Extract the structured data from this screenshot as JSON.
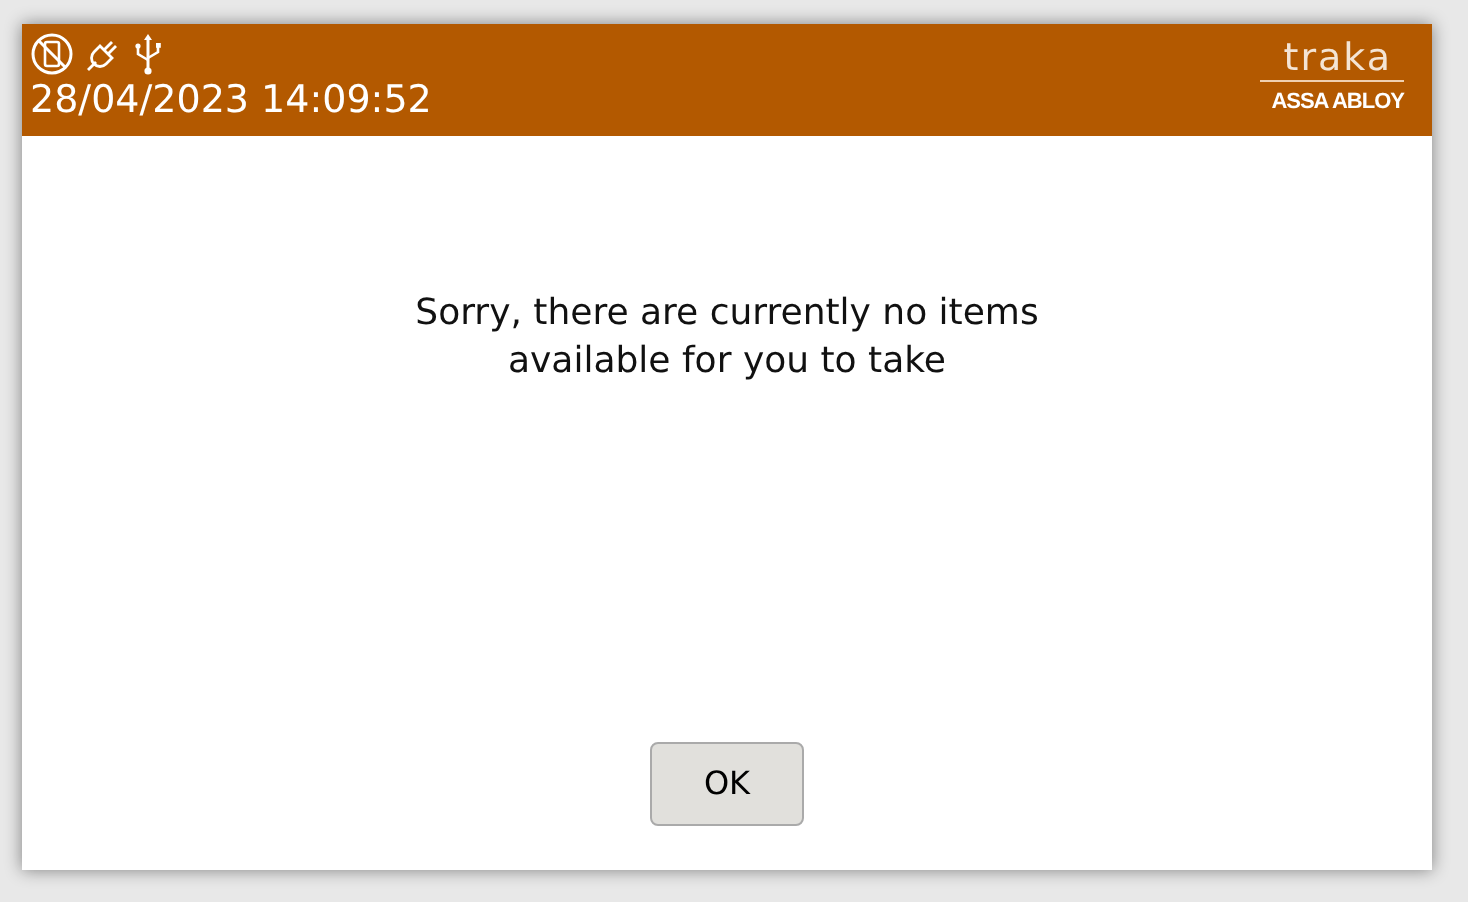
{
  "header": {
    "datetime": "28/04/2023 14:09:52",
    "logo": {
      "brand": "traka",
      "parent": "ASSA ABLOY"
    }
  },
  "message": {
    "lines": [
      "Sorry, there are currently no items",
      "available for you to take"
    ]
  },
  "buttons": [
    {
      "label": "OK"
    }
  ]
}
